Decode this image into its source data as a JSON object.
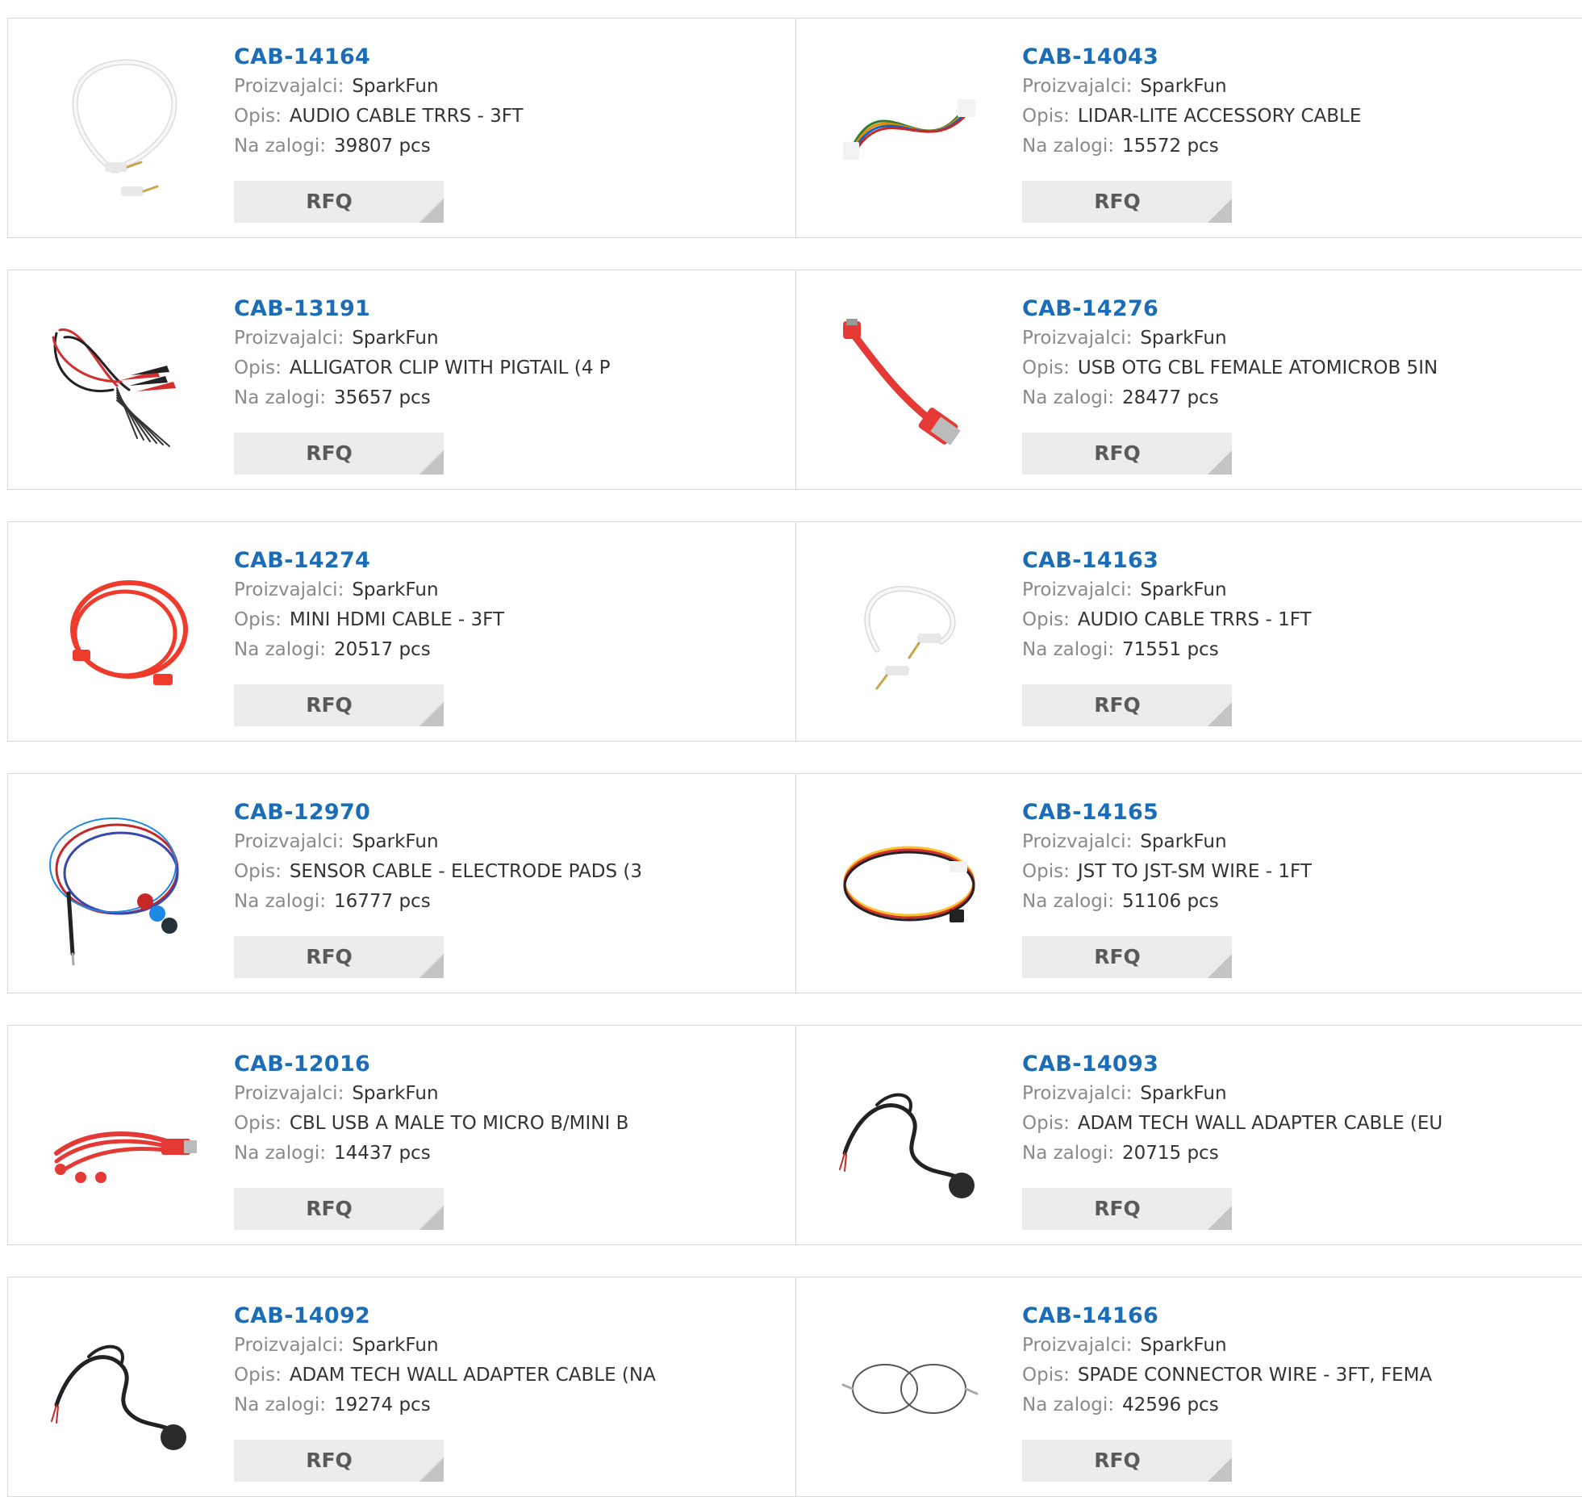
{
  "labels": {
    "manufacturer": "Proizvajalci:",
    "description": "Opis:",
    "stock": "Na zalogi:",
    "rfq": "RFQ"
  },
  "products": [
    {
      "part": "CAB-14164",
      "manufacturer": "SparkFun",
      "description": "AUDIO CABLE TRRS - 3FT",
      "stock": "39807 pcs",
      "image": "white-audio-cable-3ft",
      "colors": [
        "#f2f2f2"
      ]
    },
    {
      "part": "CAB-14043",
      "manufacturer": "SparkFun",
      "description": "LIDAR-LITE ACCESSORY CABLE",
      "stock": "15572 pcs",
      "image": "multicolor-ribbon-cable",
      "colors": [
        "#2e7d32",
        "#e68a00",
        "#1565c0",
        "#c62828"
      ]
    },
    {
      "part": "CAB-13191",
      "manufacturer": "SparkFun",
      "description": "ALLIGATOR CLIP WITH PIGTAIL (4 P",
      "stock": "35657 pcs",
      "image": "alligator-clip-pigtail",
      "colors": [
        "#d32f2f",
        "#222222"
      ]
    },
    {
      "part": "CAB-14276",
      "manufacturer": "SparkFun",
      "description": "USB OTG CBL FEMALE ATOMICROB 5IN",
      "stock": "28477 pcs",
      "image": "red-usb-otg-cable",
      "colors": [
        "#e53935"
      ]
    },
    {
      "part": "CAB-14274",
      "manufacturer": "SparkFun",
      "description": "MINI HDMI CABLE - 3FT",
      "stock": "20517 pcs",
      "image": "red-mini-hdmi-cable",
      "colors": [
        "#ef3b2c"
      ]
    },
    {
      "part": "CAB-14163",
      "manufacturer": "SparkFun",
      "description": "AUDIO CABLE TRRS - 1FT",
      "stock": "71551 pcs",
      "image": "white-audio-cable-1ft",
      "colors": [
        "#f2f2f2"
      ]
    },
    {
      "part": "CAB-12970",
      "manufacturer": "SparkFun",
      "description": "SENSOR CABLE - ELECTRODE PADS (3",
      "stock": "16777 pcs",
      "image": "sensor-electrode-cable",
      "colors": [
        "#c62828",
        "#3949ab",
        "#1e88e5"
      ]
    },
    {
      "part": "CAB-14165",
      "manufacturer": "SparkFun",
      "description": "JST TO JST-SM WIRE - 1FT",
      "stock": "51106 pcs",
      "image": "jst-wire",
      "colors": [
        "#fbc02d",
        "#d32f2f",
        "#222222"
      ]
    },
    {
      "part": "CAB-12016",
      "manufacturer": "SparkFun",
      "description": "CBL USB A MALE TO MICRO B/MINI B",
      "stock": "14437 pcs",
      "image": "red-usb-multi-cable",
      "colors": [
        "#e53935"
      ]
    },
    {
      "part": "CAB-14093",
      "manufacturer": "SparkFun",
      "description": "ADAM TECH WALL ADAPTER CABLE (EU",
      "stock": "20715 pcs",
      "image": "eu-wall-adapter-cable",
      "colors": [
        "#222222"
      ]
    },
    {
      "part": "CAB-14092",
      "manufacturer": "SparkFun",
      "description": "ADAM TECH WALL ADAPTER CABLE (NA",
      "stock": "19274 pcs",
      "image": "na-wall-adapter-cable",
      "colors": [
        "#222222"
      ]
    },
    {
      "part": "CAB-14166",
      "manufacturer": "SparkFun",
      "description": "SPADE CONNECTOR WIRE - 3FT, FEMA",
      "stock": "42596 pcs",
      "image": "spade-connector-wire",
      "colors": [
        "#555555"
      ]
    }
  ]
}
